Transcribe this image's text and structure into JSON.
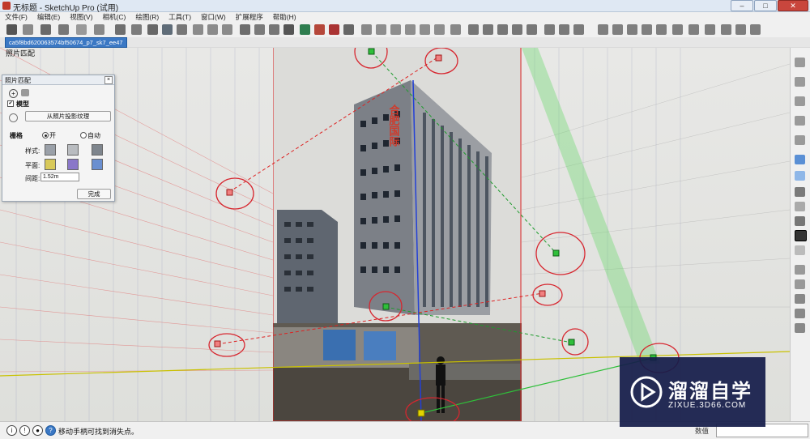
{
  "window": {
    "title": "无标题 - SketchUp Pro (试用)",
    "minimize": "–",
    "maximize": "□",
    "close": "✕"
  },
  "menu": [
    "文件(F)",
    "编辑(E)",
    "视图(V)",
    "相机(C)",
    "绘图(R)",
    "工具(T)",
    "窗口(W)",
    "扩展程序",
    "帮助(H)"
  ],
  "scene_tab": "ca5f8bd620063574bf50674_p7_sk7_ee47",
  "scene_label": "照片匹配",
  "panel": {
    "title": "照片匹配",
    "close": "×",
    "model_label": "模型",
    "model_checked": true,
    "project_button": "从照片投影纹理",
    "grid_label": "栅格",
    "grid_on": "开",
    "grid_auto": "自动",
    "grid_selected": "开",
    "style_label": "样式:",
    "plane_label": "平面:",
    "spacing_label": "间距:",
    "spacing_value": "1.52m",
    "done_button": "完成"
  },
  "building_sign": "合肥国际",
  "status": {
    "text": "移动手柄可找到消失点。",
    "measure_label": "数值",
    "measure_value": ""
  },
  "watermark": {
    "title": "溜溜自学",
    "subtitle": "ZIXUE.3D66.COM"
  },
  "colors": {
    "accent": "#3b78c4",
    "marker_circle": "#d7262f",
    "green_axis": "#2fbf3a",
    "blue_axis": "#2340d6",
    "red_axis": "#d22",
    "yellow_horizon": "#c9c100"
  }
}
